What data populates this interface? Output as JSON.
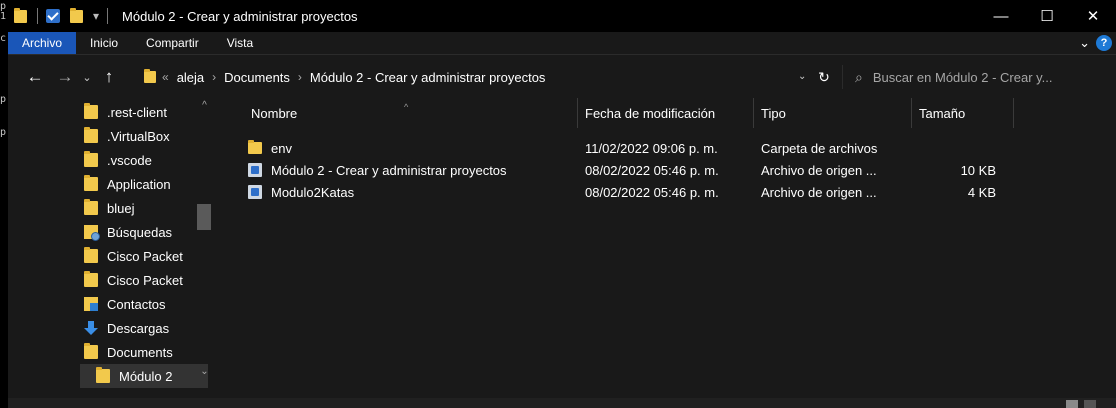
{
  "window": {
    "title": "Módulo 2 - Crear y administrar proyectos",
    "minimize_glyph": "—",
    "maximize_glyph": "☐",
    "close_glyph": "✕"
  },
  "quick_access": {
    "dropdown_glyph": "▾"
  },
  "left_strip_chars": [
    "p",
    "1",
    "c",
    "p",
    "p"
  ],
  "ribbon": {
    "tabs": [
      {
        "label": "Archivo",
        "active": true
      },
      {
        "label": "Inicio",
        "active": false
      },
      {
        "label": "Compartir",
        "active": false
      },
      {
        "label": "Vista",
        "active": false
      }
    ],
    "expand_glyph": "⌄",
    "help_glyph": "?"
  },
  "navigation": {
    "back_glyph": "←",
    "forward_glyph": "→",
    "recent_glyph": "⌄",
    "up_glyph": "↑",
    "overflow_glyph": "«",
    "breadcrumb": [
      "aleja",
      "Documents",
      "Módulo 2 - Crear y administrar proyectos"
    ],
    "crumb_separator": "›",
    "dropdown_glyph": "⌄",
    "refresh_glyph": "↻"
  },
  "search": {
    "placeholder": "Buscar en Módulo 2 - Crear y...",
    "icon_glyph": "⌕"
  },
  "nav_pane": {
    "items": [
      {
        "label": ".rest-client",
        "icon": "folder-icon"
      },
      {
        "label": ".VirtualBox",
        "icon": "folder-icon"
      },
      {
        "label": ".vscode",
        "icon": "folder-icon"
      },
      {
        "label": "Application",
        "icon": "folder-icon"
      },
      {
        "label": "bluej",
        "icon": "folder-icon"
      },
      {
        "label": "Búsquedas",
        "icon": "searches-folder-icon"
      },
      {
        "label": "Cisco Packet",
        "icon": "folder-icon"
      },
      {
        "label": "Cisco Packet",
        "icon": "folder-icon"
      },
      {
        "label": "Contactos",
        "icon": "contacts-folder-icon"
      },
      {
        "label": "Descargas",
        "icon": "download-icon"
      },
      {
        "label": "Documents",
        "icon": "folder-icon"
      },
      {
        "label": "Módulo 2",
        "icon": "folder-icon",
        "selected": true
      }
    ],
    "scroll_up_glyph": "^",
    "scroll_down_glyph": "⌄"
  },
  "file_list": {
    "sort_glyph": "^",
    "columns": [
      "Nombre",
      "Fecha de modificación",
      "Tipo",
      "Tamaño"
    ],
    "rows": [
      {
        "name": "env",
        "date": "11/02/2022 09:06 p. m.",
        "type": "Carpeta de archivos",
        "size": "",
        "icon": "folder-icon"
      },
      {
        "name": "Módulo 2 - Crear y administrar proyectos",
        "date": "08/02/2022 05:46 p. m.",
        "type": "Archivo de origen ...",
        "size": "10 KB",
        "icon": "python-file-icon"
      },
      {
        "name": "Modulo2Katas",
        "date": "08/02/2022 05:46 p. m.",
        "type": "Archivo de origen ...",
        "size": "4 KB",
        "icon": "python-file-icon"
      }
    ]
  },
  "colors": {
    "accent": "#1a56b8",
    "folder": "#f2c94c",
    "background": "#191919"
  }
}
